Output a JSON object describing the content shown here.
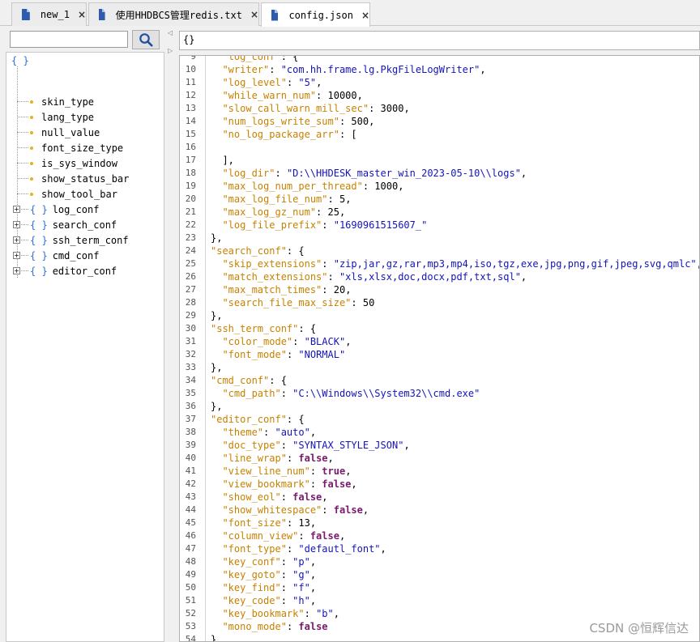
{
  "tabs": [
    {
      "label": "new_1",
      "close": "×",
      "active": false
    },
    {
      "label": "使用HHDBCS管理redis.txt",
      "close": "×",
      "active": false
    },
    {
      "label": "config.json",
      "close": "×",
      "active": true
    }
  ],
  "search": {
    "value": "",
    "placeholder": ""
  },
  "tree": {
    "root_label": "{ }",
    "leaves": [
      "skin_type",
      "lang_type",
      "null_value",
      "font_size_type",
      "is_sys_window",
      "show_status_bar",
      "show_tool_bar"
    ],
    "objects": [
      "log_conf",
      "search_conf",
      "ssh_term_conf",
      "cmd_conf",
      "editor_conf"
    ],
    "object_icon": "{ }",
    "expander": "+"
  },
  "path_field": "{}",
  "editor": {
    "lines": [
      {
        "num": "9",
        "tokens": [
          {
            "t": "  ",
            "c": "p"
          },
          {
            "t": "\"log_conf\"",
            "c": "k"
          },
          {
            "t": ": {",
            "c": "p"
          }
        ]
      },
      {
        "num": "10",
        "tokens": [
          {
            "t": "  ",
            "c": "p"
          },
          {
            "t": "\"writer\"",
            "c": "k"
          },
          {
            "t": ": ",
            "c": "p"
          },
          {
            "t": "\"com.hh.frame.lg.PkgFileLogWriter\"",
            "c": "s"
          },
          {
            "t": ",",
            "c": "p"
          }
        ]
      },
      {
        "num": "11",
        "tokens": [
          {
            "t": "  ",
            "c": "p"
          },
          {
            "t": "\"log_level\"",
            "c": "k"
          },
          {
            "t": ": ",
            "c": "p"
          },
          {
            "t": "\"5\"",
            "c": "s"
          },
          {
            "t": ",",
            "c": "p"
          }
        ]
      },
      {
        "num": "12",
        "tokens": [
          {
            "t": "  ",
            "c": "p"
          },
          {
            "t": "\"while_warn_num\"",
            "c": "k"
          },
          {
            "t": ": ",
            "c": "p"
          },
          {
            "t": "10000",
            "c": "n"
          },
          {
            "t": ",",
            "c": "p"
          }
        ]
      },
      {
        "num": "13",
        "tokens": [
          {
            "t": "  ",
            "c": "p"
          },
          {
            "t": "\"slow_call_warn_mill_sec\"",
            "c": "k"
          },
          {
            "t": ": ",
            "c": "p"
          },
          {
            "t": "3000",
            "c": "n"
          },
          {
            "t": ",",
            "c": "p"
          }
        ]
      },
      {
        "num": "14",
        "tokens": [
          {
            "t": "  ",
            "c": "p"
          },
          {
            "t": "\"num_logs_write_sum\"",
            "c": "k"
          },
          {
            "t": ": ",
            "c": "p"
          },
          {
            "t": "500",
            "c": "n"
          },
          {
            "t": ",",
            "c": "p"
          }
        ]
      },
      {
        "num": "15",
        "tokens": [
          {
            "t": "  ",
            "c": "p"
          },
          {
            "t": "\"no_log_package_arr\"",
            "c": "k"
          },
          {
            "t": ": [",
            "c": "p"
          }
        ]
      },
      {
        "num": "16",
        "tokens": []
      },
      {
        "num": "17",
        "tokens": [
          {
            "t": "  ],",
            "c": "p"
          }
        ]
      },
      {
        "num": "18",
        "tokens": [
          {
            "t": "  ",
            "c": "p"
          },
          {
            "t": "\"log_dir\"",
            "c": "k"
          },
          {
            "t": ": ",
            "c": "p"
          },
          {
            "t": "\"D:\\\\HHDESK_master_win_2023-05-10\\\\logs\"",
            "c": "s"
          },
          {
            "t": ",",
            "c": "p"
          }
        ]
      },
      {
        "num": "19",
        "tokens": [
          {
            "t": "  ",
            "c": "p"
          },
          {
            "t": "\"max_log_num_per_thread\"",
            "c": "k"
          },
          {
            "t": ": ",
            "c": "p"
          },
          {
            "t": "1000",
            "c": "n"
          },
          {
            "t": ",",
            "c": "p"
          }
        ]
      },
      {
        "num": "20",
        "tokens": [
          {
            "t": "  ",
            "c": "p"
          },
          {
            "t": "\"max_log_file_num\"",
            "c": "k"
          },
          {
            "t": ": ",
            "c": "p"
          },
          {
            "t": "5",
            "c": "n"
          },
          {
            "t": ",",
            "c": "p"
          }
        ]
      },
      {
        "num": "21",
        "tokens": [
          {
            "t": "  ",
            "c": "p"
          },
          {
            "t": "\"max_log_gz_num\"",
            "c": "k"
          },
          {
            "t": ": ",
            "c": "p"
          },
          {
            "t": "25",
            "c": "n"
          },
          {
            "t": ",",
            "c": "p"
          }
        ]
      },
      {
        "num": "22",
        "tokens": [
          {
            "t": "  ",
            "c": "p"
          },
          {
            "t": "\"log_file_prefix\"",
            "c": "k"
          },
          {
            "t": ": ",
            "c": "p"
          },
          {
            "t": "\"1690961515607_\"",
            "c": "s"
          }
        ]
      },
      {
        "num": "23",
        "tokens": [
          {
            "t": "},",
            "c": "p"
          }
        ]
      },
      {
        "num": "24",
        "tokens": [
          {
            "t": "\"search_conf\"",
            "c": "k"
          },
          {
            "t": ": {",
            "c": "p"
          }
        ]
      },
      {
        "num": "25",
        "tokens": [
          {
            "t": "  ",
            "c": "p"
          },
          {
            "t": "\"skip_extensions\"",
            "c": "k"
          },
          {
            "t": ": ",
            "c": "p"
          },
          {
            "t": "\"zip,jar,gz,rar,mp3,mp4,iso,tgz,exe,jpg,png,gif,jpeg,svg,qmlc\"",
            "c": "s"
          },
          {
            "t": ",",
            "c": "p"
          }
        ]
      },
      {
        "num": "26",
        "tokens": [
          {
            "t": "  ",
            "c": "p"
          },
          {
            "t": "\"match_extensions\"",
            "c": "k"
          },
          {
            "t": ": ",
            "c": "p"
          },
          {
            "t": "\"xls,xlsx,doc,docx,pdf,txt,sql\"",
            "c": "s"
          },
          {
            "t": ",",
            "c": "p"
          }
        ]
      },
      {
        "num": "27",
        "tokens": [
          {
            "t": "  ",
            "c": "p"
          },
          {
            "t": "\"max_match_times\"",
            "c": "k"
          },
          {
            "t": ": ",
            "c": "p"
          },
          {
            "t": "20",
            "c": "n"
          },
          {
            "t": ",",
            "c": "p"
          }
        ]
      },
      {
        "num": "28",
        "tokens": [
          {
            "t": "  ",
            "c": "p"
          },
          {
            "t": "\"search_file_max_size\"",
            "c": "k"
          },
          {
            "t": ": ",
            "c": "p"
          },
          {
            "t": "50",
            "c": "n"
          }
        ]
      },
      {
        "num": "29",
        "tokens": [
          {
            "t": "},",
            "c": "p"
          }
        ]
      },
      {
        "num": "30",
        "tokens": [
          {
            "t": "\"ssh_term_conf\"",
            "c": "k"
          },
          {
            "t": ": {",
            "c": "p"
          }
        ]
      },
      {
        "num": "31",
        "tokens": [
          {
            "t": "  ",
            "c": "p"
          },
          {
            "t": "\"color_mode\"",
            "c": "k"
          },
          {
            "t": ": ",
            "c": "p"
          },
          {
            "t": "\"BLACK\"",
            "c": "s"
          },
          {
            "t": ",",
            "c": "p"
          }
        ]
      },
      {
        "num": "32",
        "tokens": [
          {
            "t": "  ",
            "c": "p"
          },
          {
            "t": "\"font_mode\"",
            "c": "k"
          },
          {
            "t": ": ",
            "c": "p"
          },
          {
            "t": "\"NORMAL\"",
            "c": "s"
          }
        ]
      },
      {
        "num": "33",
        "tokens": [
          {
            "t": "},",
            "c": "p"
          }
        ]
      },
      {
        "num": "34",
        "tokens": [
          {
            "t": "\"cmd_conf\"",
            "c": "k"
          },
          {
            "t": ": {",
            "c": "p"
          }
        ]
      },
      {
        "num": "35",
        "tokens": [
          {
            "t": "  ",
            "c": "p"
          },
          {
            "t": "\"cmd_path\"",
            "c": "k"
          },
          {
            "t": ": ",
            "c": "p"
          },
          {
            "t": "\"C:\\\\Windows\\\\System32\\\\cmd.exe\"",
            "c": "s"
          }
        ]
      },
      {
        "num": "36",
        "tokens": [
          {
            "t": "},",
            "c": "p"
          }
        ]
      },
      {
        "num": "37",
        "tokens": [
          {
            "t": "\"editor_conf\"",
            "c": "k"
          },
          {
            "t": ": {",
            "c": "p"
          }
        ]
      },
      {
        "num": "38",
        "tokens": [
          {
            "t": "  ",
            "c": "p"
          },
          {
            "t": "\"theme\"",
            "c": "k"
          },
          {
            "t": ": ",
            "c": "p"
          },
          {
            "t": "\"auto\"",
            "c": "s"
          },
          {
            "t": ",",
            "c": "p"
          }
        ]
      },
      {
        "num": "39",
        "tokens": [
          {
            "t": "  ",
            "c": "p"
          },
          {
            "t": "\"doc_type\"",
            "c": "k"
          },
          {
            "t": ": ",
            "c": "p"
          },
          {
            "t": "\"SYNTAX_STYLE_JSON\"",
            "c": "s"
          },
          {
            "t": ",",
            "c": "p"
          }
        ]
      },
      {
        "num": "40",
        "tokens": [
          {
            "t": "  ",
            "c": "p"
          },
          {
            "t": "\"line_wrap\"",
            "c": "k"
          },
          {
            "t": ": ",
            "c": "p"
          },
          {
            "t": "false",
            "c": "b"
          },
          {
            "t": ",",
            "c": "p"
          }
        ]
      },
      {
        "num": "41",
        "tokens": [
          {
            "t": "  ",
            "c": "p"
          },
          {
            "t": "\"view_line_num\"",
            "c": "k"
          },
          {
            "t": ": ",
            "c": "p"
          },
          {
            "t": "true",
            "c": "b"
          },
          {
            "t": ",",
            "c": "p"
          }
        ]
      },
      {
        "num": "42",
        "tokens": [
          {
            "t": "  ",
            "c": "p"
          },
          {
            "t": "\"view_bookmark\"",
            "c": "k"
          },
          {
            "t": ": ",
            "c": "p"
          },
          {
            "t": "false",
            "c": "b"
          },
          {
            "t": ",",
            "c": "p"
          }
        ]
      },
      {
        "num": "43",
        "tokens": [
          {
            "t": "  ",
            "c": "p"
          },
          {
            "t": "\"show_eol\"",
            "c": "k"
          },
          {
            "t": ": ",
            "c": "p"
          },
          {
            "t": "false",
            "c": "b"
          },
          {
            "t": ",",
            "c": "p"
          }
        ]
      },
      {
        "num": "44",
        "tokens": [
          {
            "t": "  ",
            "c": "p"
          },
          {
            "t": "\"show_whitespace\"",
            "c": "k"
          },
          {
            "t": ": ",
            "c": "p"
          },
          {
            "t": "false",
            "c": "b"
          },
          {
            "t": ",",
            "c": "p"
          }
        ]
      },
      {
        "num": "45",
        "tokens": [
          {
            "t": "  ",
            "c": "p"
          },
          {
            "t": "\"font_size\"",
            "c": "k"
          },
          {
            "t": ": ",
            "c": "p"
          },
          {
            "t": "13",
            "c": "n"
          },
          {
            "t": ",",
            "c": "p"
          }
        ]
      },
      {
        "num": "46",
        "tokens": [
          {
            "t": "  ",
            "c": "p"
          },
          {
            "t": "\"column_view\"",
            "c": "k"
          },
          {
            "t": ": ",
            "c": "p"
          },
          {
            "t": "false",
            "c": "b"
          },
          {
            "t": ",",
            "c": "p"
          }
        ]
      },
      {
        "num": "47",
        "tokens": [
          {
            "t": "  ",
            "c": "p"
          },
          {
            "t": "\"font_type\"",
            "c": "k"
          },
          {
            "t": ": ",
            "c": "p"
          },
          {
            "t": "\"defautl_font\"",
            "c": "s"
          },
          {
            "t": ",",
            "c": "p"
          }
        ]
      },
      {
        "num": "48",
        "tokens": [
          {
            "t": "  ",
            "c": "p"
          },
          {
            "t": "\"key_conf\"",
            "c": "k"
          },
          {
            "t": ": ",
            "c": "p"
          },
          {
            "t": "\"p\"",
            "c": "s"
          },
          {
            "t": ",",
            "c": "p"
          }
        ]
      },
      {
        "num": "49",
        "tokens": [
          {
            "t": "  ",
            "c": "p"
          },
          {
            "t": "\"key_goto\"",
            "c": "k"
          },
          {
            "t": ": ",
            "c": "p"
          },
          {
            "t": "\"g\"",
            "c": "s"
          },
          {
            "t": ",",
            "c": "p"
          }
        ]
      },
      {
        "num": "50",
        "tokens": [
          {
            "t": "  ",
            "c": "p"
          },
          {
            "t": "\"key_find\"",
            "c": "k"
          },
          {
            "t": ": ",
            "c": "p"
          },
          {
            "t": "\"f\"",
            "c": "s"
          },
          {
            "t": ",",
            "c": "p"
          }
        ]
      },
      {
        "num": "51",
        "tokens": [
          {
            "t": "  ",
            "c": "p"
          },
          {
            "t": "\"key_code\"",
            "c": "k"
          },
          {
            "t": ": ",
            "c": "p"
          },
          {
            "t": "\"h\"",
            "c": "s"
          },
          {
            "t": ",",
            "c": "p"
          }
        ]
      },
      {
        "num": "52",
        "tokens": [
          {
            "t": "  ",
            "c": "p"
          },
          {
            "t": "\"key_bookmark\"",
            "c": "k"
          },
          {
            "t": ": ",
            "c": "p"
          },
          {
            "t": "\"b\"",
            "c": "s"
          },
          {
            "t": ",",
            "c": "p"
          }
        ]
      },
      {
        "num": "53",
        "tokens": [
          {
            "t": "  ",
            "c": "p"
          },
          {
            "t": "\"mono_mode\"",
            "c": "k"
          },
          {
            "t": ": ",
            "c": "p"
          },
          {
            "t": "false",
            "c": "b"
          }
        ]
      },
      {
        "num": "54",
        "tokens": [
          {
            "t": "}",
            "c": "p"
          }
        ]
      }
    ]
  },
  "watermark": "CSDN @恒辉信达",
  "icons": {
    "tab": "document-icon",
    "search": "search-icon",
    "tree_leaf": "leaf-dot-icon",
    "tree_object": "json-object-icon",
    "expand": "plus-expander-icon"
  },
  "colors": {
    "key": "#c68200",
    "string": "#1414b8",
    "boolean": "#7a1a6e",
    "tab_icon": "#2d5bb0",
    "tree_icon": "#2a6fd6",
    "leaf_dot": "#e3b21c"
  }
}
